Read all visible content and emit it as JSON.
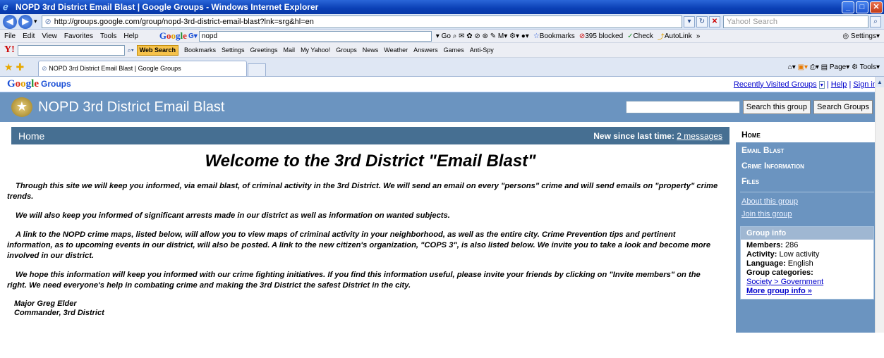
{
  "window": {
    "title": "NOPD 3rd District Email Blast | Google Groups - Windows Internet Explorer"
  },
  "address": {
    "url": "http://groups.google.com/group/nopd-3rd-district-email-blast?lnk=srg&hl=en",
    "search_placeholder": "Yahoo! Search"
  },
  "menu": {
    "items": [
      "File",
      "Edit",
      "View",
      "Favorites",
      "Tools",
      "Help"
    ],
    "google_query": "nopd",
    "go": "Go",
    "bookmarks": "Bookmarks",
    "blocked": "395 blocked",
    "check": "Check",
    "autolink": "AutoLink",
    "more": "»",
    "settings": "Settings"
  },
  "yahoo_toolbar": {
    "web_search": "Web Search",
    "items": [
      "Bookmarks",
      "Settings",
      "Greetings",
      "Mail",
      "My Yahoo!",
      "Groups",
      "News",
      "Weather",
      "Answers",
      "Games",
      "Anti-Spy"
    ]
  },
  "tabs": {
    "active_tab": "NOPD 3rd District Email Blast | Google Groups",
    "page": "Page",
    "tools": "Tools"
  },
  "groups_header": {
    "logo_google": [
      "G",
      "o",
      "o",
      "g",
      "l",
      "e"
    ],
    "logo_groups": "Groups",
    "recently_visited": "Recently Visited Groups",
    "help": "Help",
    "sign_in": "Sign in",
    "separator": "|"
  },
  "banner": {
    "group_name": "NOPD 3rd District Email Blast",
    "search_this_group": "Search this group",
    "search_groups": "Search Groups"
  },
  "main": {
    "home_label": "Home",
    "new_since_label": "New since last time:",
    "new_messages": "2 messages",
    "welcome": "Welcome to the 3rd District \"Email Blast\"",
    "paragraphs": [
      "Through this site we will keep you informed, via email blast, of criminal activity in the 3rd District.  We will send an email on every \"persons\" crime and will send emails on \"property\" crime trends.",
      "We will also keep you informed of significant arrests made in our district as well as information on wanted subjects.",
      "A link to the NOPD crime maps, listed below, will allow you to view maps of criminal activity in your neighborhood, as well as the entire city. Crime Prevention tips and pertinent information, as to upcoming events in our district, will also be posted. A link to the new citizen's organization, \"COPS 3\", is also listed below. We invite you to take a look and become more involved in our district.",
      "We hope this information will keep you informed with our crime fighting initiatives.  If you find this information useful, please invite your friends by clicking on \"Invite members\" on the right. We need everyone's help in combating crime and making the 3rd District the safest District in the city."
    ],
    "signature_name": "Major Greg Elder",
    "signature_title": "Commander, 3rd District"
  },
  "sidebar": {
    "home": "Home",
    "nav": [
      "Email Blast",
      "Crime Information",
      "Files"
    ],
    "about": "About this group",
    "join": "Join this group",
    "group_info_title": "Group info",
    "members_label": "Members:",
    "members_value": "286",
    "activity_label": "Activity:",
    "activity_value": "Low activity",
    "language_label": "Language:",
    "language_value": "English",
    "categories_label": "Group categories:",
    "categories_value": "Society > Government",
    "more_info": "More group info »"
  },
  "colors": {
    "banner": "#6b94c0",
    "home_bar": "#466f92",
    "link": "#0000cc"
  }
}
